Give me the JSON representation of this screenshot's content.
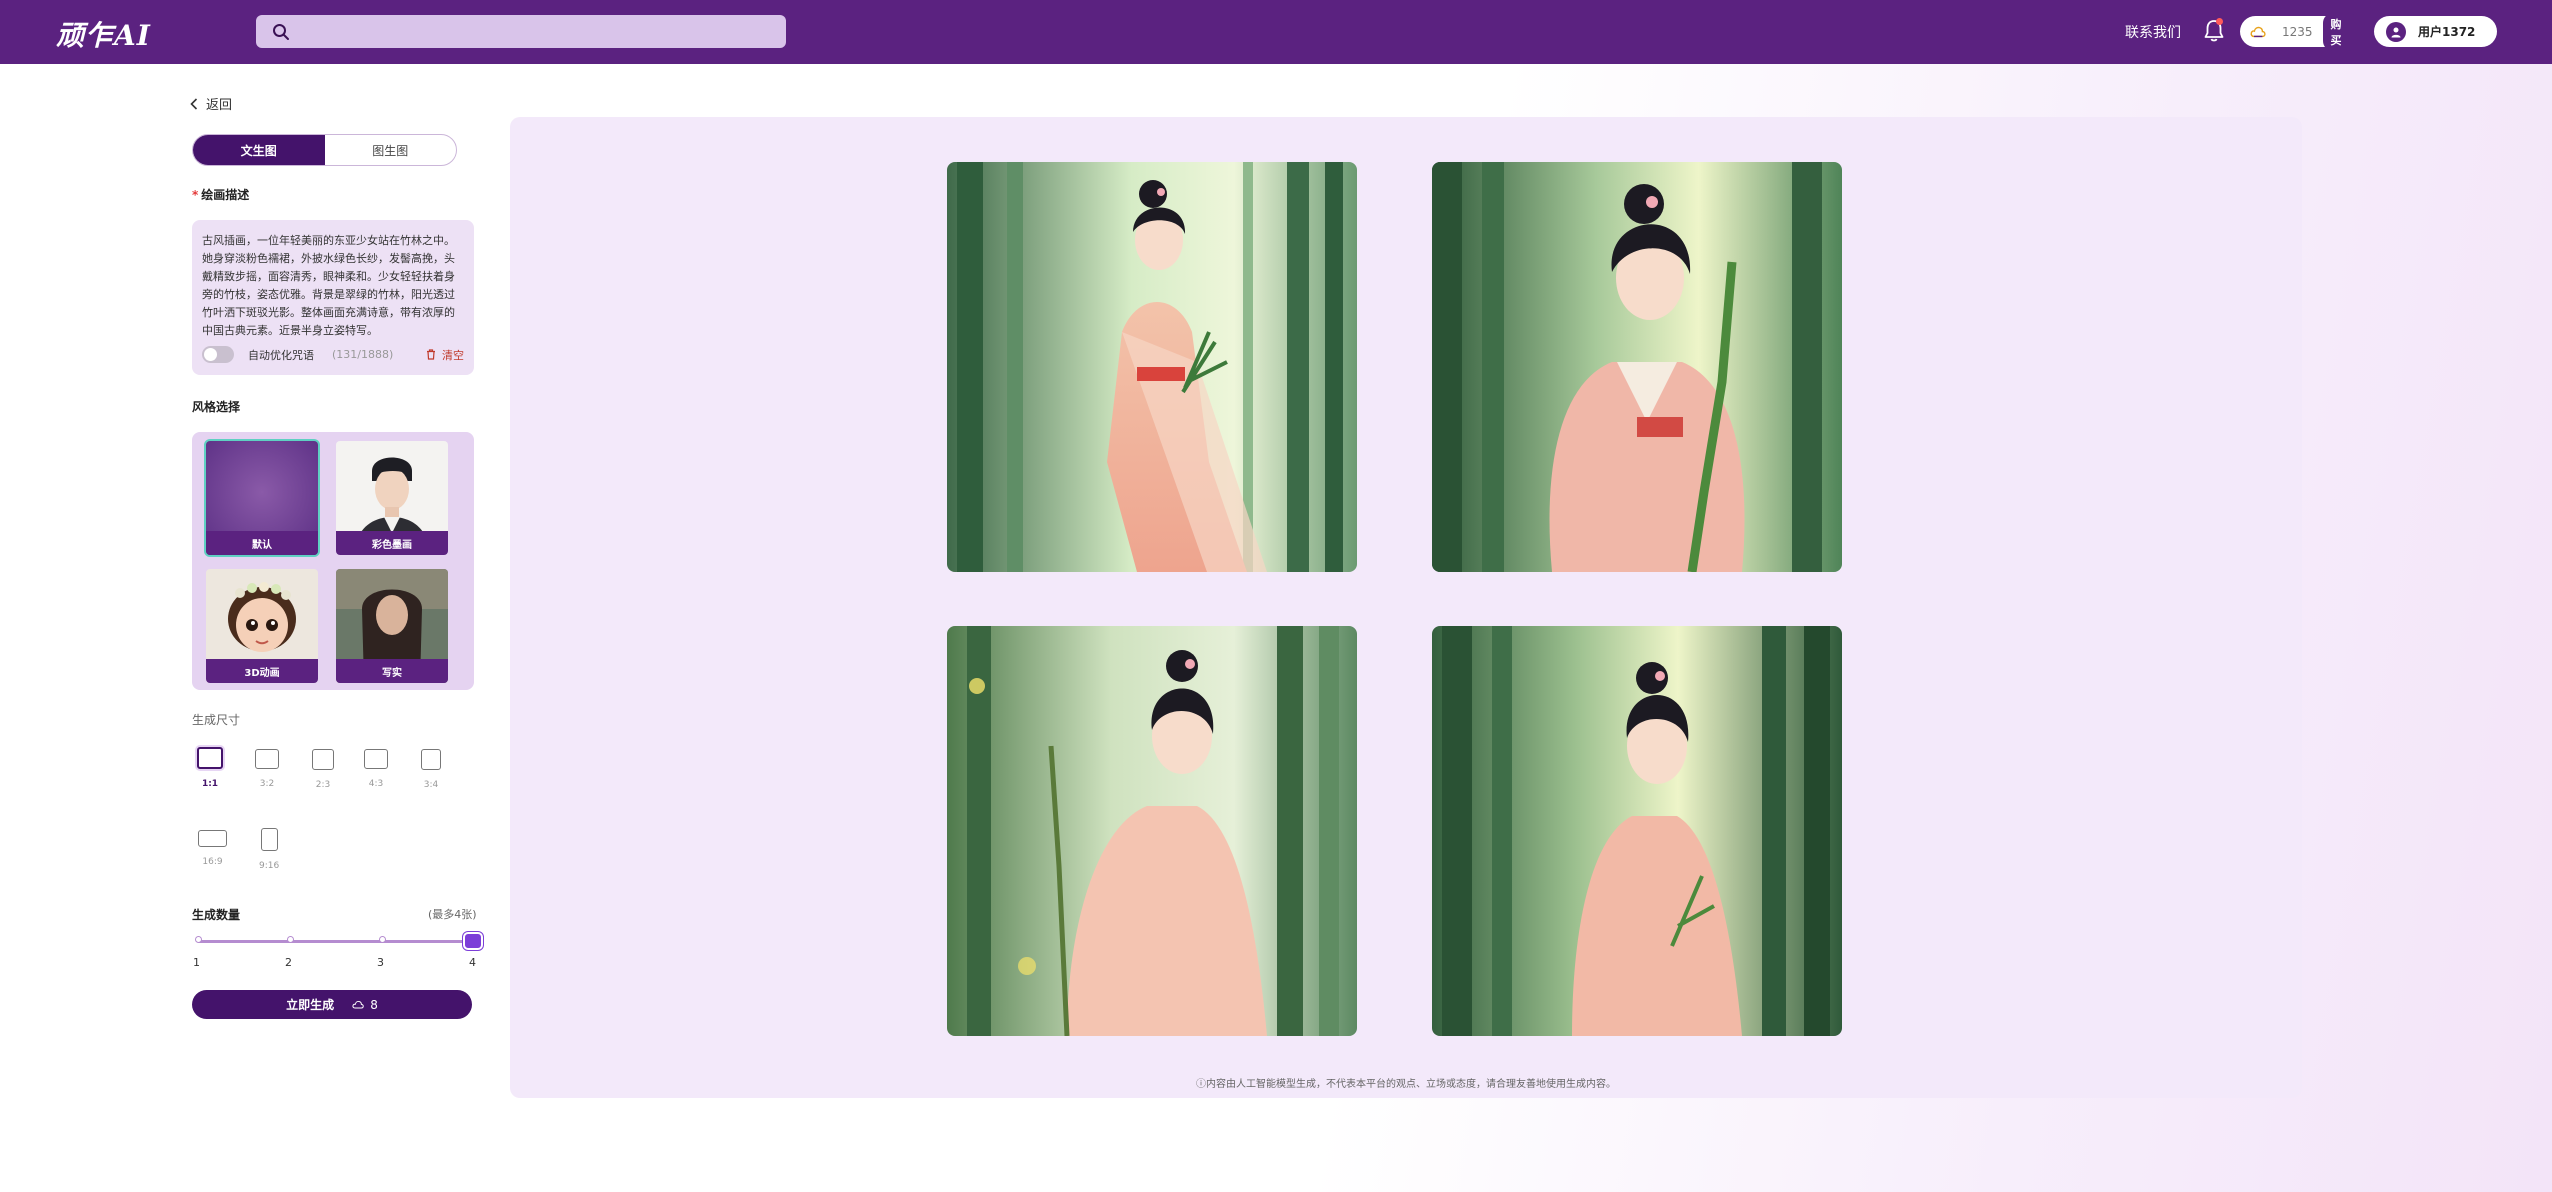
{
  "header": {
    "logo": "顽乍AI",
    "search_placeholder": "",
    "contact": "联系我们",
    "credits": "1235",
    "buy_label": "购买",
    "username": "用户1372"
  },
  "sidebar": {
    "back_label": "返回",
    "tabs": [
      {
        "label": "文生图",
        "active": true
      },
      {
        "label": "图生图",
        "active": false
      }
    ],
    "prompt_label": "绘画描述",
    "prompt_text": "古风插画，一位年轻美丽的东亚少女站在竹林之中。她身穿淡粉色襦裙，外披水绿色长纱，发髻高挽，头戴精致步摇，面容清秀，眼神柔和。少女轻轻扶着身旁的竹枝，姿态优雅。背景是翠绿的竹林，阳光透过竹叶洒下斑驳光影。整体画面充满诗意，带有浓厚的中国古典元素。近景半身立姿特写。",
    "auto_optimize_label": "自动优化咒语",
    "char_counter": "(131/1888)",
    "clear_label": "清空",
    "style_label": "风格选择",
    "styles": [
      {
        "label": "默认",
        "selected": true
      },
      {
        "label": "彩色墨画",
        "selected": false
      },
      {
        "label": "3D动画",
        "selected": false
      },
      {
        "label": "写实",
        "selected": false
      }
    ],
    "size_label": "生成尺寸",
    "sizes": [
      {
        "label": "1:1",
        "selected": true
      },
      {
        "label": "3:2",
        "selected": false
      },
      {
        "label": "2:3",
        "selected": false
      },
      {
        "label": "4:3",
        "selected": false
      },
      {
        "label": "3:4",
        "selected": false
      },
      {
        "label": "16:9",
        "selected": false
      },
      {
        "label": "9:16",
        "selected": false
      }
    ],
    "count_label": "生成数量",
    "count_hint": "(最多4张)",
    "count_ticks": [
      "1",
      "2",
      "3",
      "4"
    ],
    "count_value": 4,
    "generate_label": "立即生成",
    "generate_cost": "8"
  },
  "main": {
    "disclaimer": "ⓘ内容由人工智能模型生成，不代表本平台的观点、立场或态度，请合理友善地使用生成内容。"
  },
  "colors": {
    "brand": "#5b2280",
    "brand_dark": "#44136b",
    "accent_selected": "#5fd0c2"
  }
}
